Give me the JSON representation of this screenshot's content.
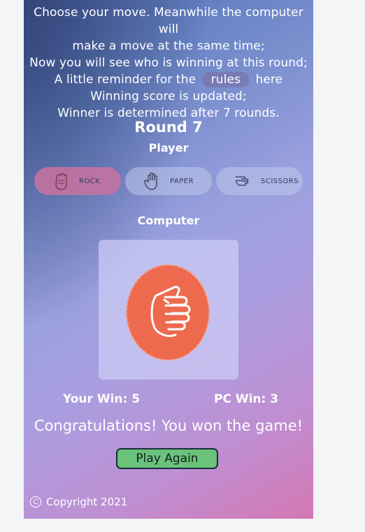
{
  "instructions": {
    "line1": "Choose your move. Meanwhile the computer will",
    "line2": "make a move at the same time;",
    "line3": "Now you will see who is winning at this round;",
    "line4_before": "A little reminder for the",
    "rules_label": "rules",
    "line4_after": "here",
    "line5": "Winning score is updated;",
    "line6": "Winner is determined after 7 rounds."
  },
  "round": {
    "title": "Round 7"
  },
  "player": {
    "label": "Player",
    "selected": "rock",
    "choices": [
      {
        "id": "rock",
        "label": "ROCK",
        "icon": "fist-icon"
      },
      {
        "id": "paper",
        "label": "PAPER",
        "icon": "open-hand-icon"
      },
      {
        "id": "scissors",
        "label": "SCISSORS",
        "icon": "scissors-hand-icon"
      }
    ]
  },
  "computer": {
    "label": "Computer",
    "move": "rock",
    "move_icon": "rock-fist-icon"
  },
  "scores": {
    "your_win": "Your Win: 5",
    "pc_win": "PC Win: 3"
  },
  "result": {
    "message": "Congratulations! You won the game!",
    "play_again_label": "Play Again"
  },
  "footer": {
    "copyright_symbol": "C",
    "copyright": "Copyright 2021"
  },
  "colors": {
    "selected_choice": "#c873a0",
    "play_again_bg": "#6bc27a",
    "rock_orange": "#ee6a4e"
  }
}
